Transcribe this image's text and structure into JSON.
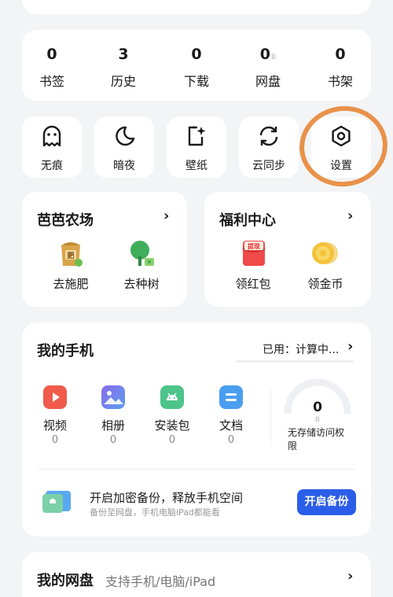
{
  "stats": [
    {
      "num": "0",
      "label": "书签",
      "suffix": ""
    },
    {
      "num": "3",
      "label": "历史",
      "suffix": ""
    },
    {
      "num": "0",
      "label": "下载",
      "suffix": ""
    },
    {
      "num": "0",
      "label": "网盘",
      "suffix": "B"
    },
    {
      "num": "0",
      "label": "书架",
      "suffix": ""
    }
  ],
  "tools": [
    {
      "label": "无痕",
      "icon": "ghost-icon"
    },
    {
      "label": "暗夜",
      "icon": "moon-icon"
    },
    {
      "label": "壁纸",
      "icon": "wallpaper-icon"
    },
    {
      "label": "云同步",
      "icon": "sync-icon"
    },
    {
      "label": "设置",
      "icon": "gear-icon"
    }
  ],
  "farm": {
    "title": "芭芭农场",
    "items": [
      {
        "label": "去施肥",
        "icon": "fertilizer-icon"
      },
      {
        "label": "去种树",
        "icon": "tree-icon"
      }
    ]
  },
  "welfare": {
    "title": "福利中心",
    "items": [
      {
        "label": "领红包",
        "icon": "red-envelope-icon",
        "tag": "提现"
      },
      {
        "label": "领金币",
        "icon": "gold-coin-icon"
      }
    ]
  },
  "phone": {
    "title": "我的手机",
    "usage": "已用：计算中...",
    "apps": [
      {
        "label": "视频",
        "count": "0",
        "color": "#f05a4a"
      },
      {
        "label": "相册",
        "count": "0",
        "color": "#6a7ee8"
      },
      {
        "label": "安装包",
        "count": "0",
        "color": "#4cc48a"
      },
      {
        "label": "文档",
        "count": "0",
        "color": "#4a9ef0"
      }
    ],
    "storage": {
      "num": "0",
      "unit": "B",
      "label": "无存储访问权限"
    },
    "backup": {
      "title": "开启加密备份，释放手机空间",
      "subtitle": "备份至网盘，手机电脑iPad都能看",
      "button": "开启备份"
    }
  },
  "netdisk": {
    "title": "我的网盘",
    "subtitle": "支持手机/电脑/iPad"
  },
  "colors": {
    "accent": "#2b5ee8",
    "highlight_circle": "#e8924a"
  }
}
